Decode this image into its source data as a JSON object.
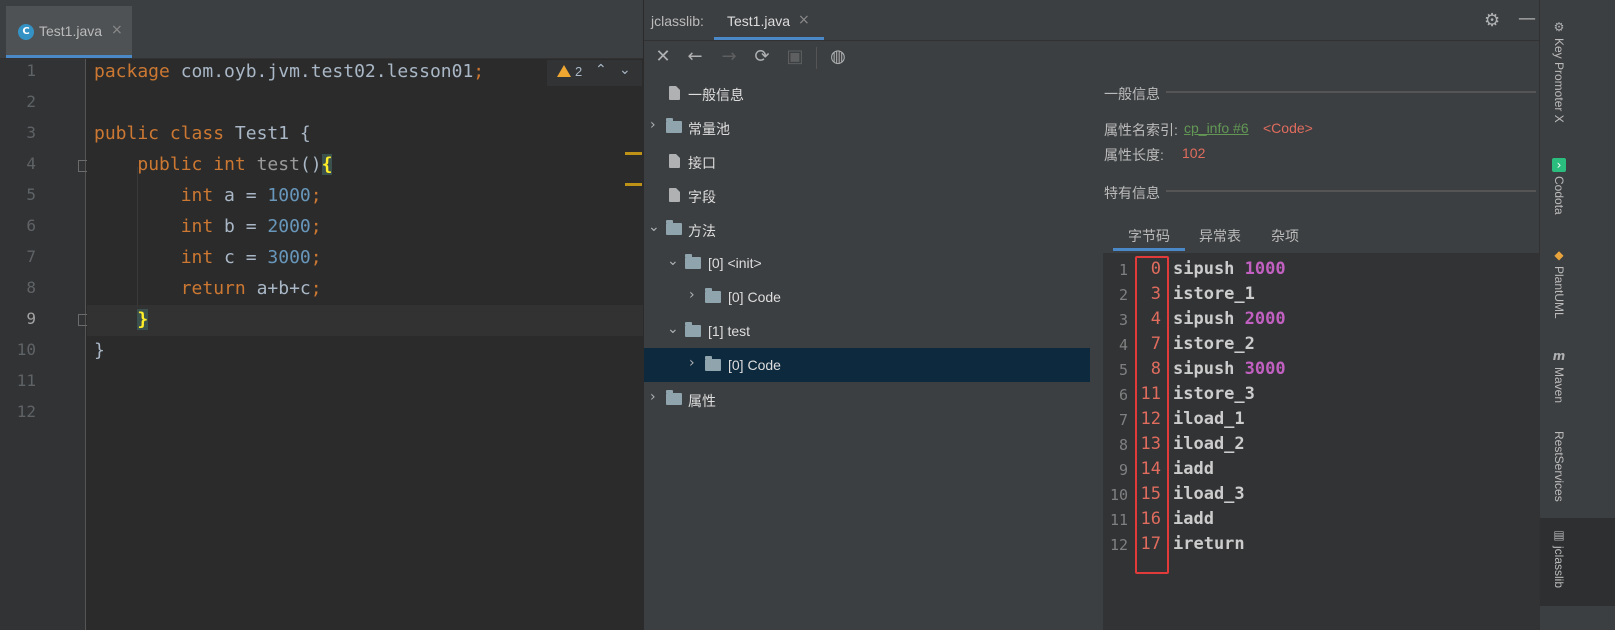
{
  "editor": {
    "tab_label": "Test1.java",
    "tab_icon_letter": "C",
    "close_glyph": "×",
    "inspection": {
      "warning_count": "2"
    },
    "line_numbers": [
      "1",
      "2",
      "3",
      "4",
      "5",
      "6",
      "7",
      "8",
      "9",
      "10",
      "11",
      "12"
    ],
    "code": {
      "l1_kw": "package",
      "l1_rest": " com.oyb.jvm.test02.lesson01",
      "l1_semi": ";",
      "l3_kw1": "public",
      "l3_kw2": "class",
      "l3_cls": "Test1",
      "l3_brace": " {",
      "l4_kw1": "public",
      "l4_kw2": "int",
      "l4_method": "test",
      "l4_parens": "()",
      "l4_brace": "{",
      "l5_kw": "int",
      "l5_var": " a = ",
      "l5_num": "1000",
      "l6_kw": "int",
      "l6_var": " b = ",
      "l6_num": "2000",
      "l7_kw": "int",
      "l7_var": " c = ",
      "l7_num": "3000",
      "l8_kw": "return",
      "l8_expr": " a+b+c",
      "semi": ";",
      "l9_brace": "}",
      "l10_brace": "}"
    }
  },
  "jclasslib": {
    "title": "jclasslib:",
    "tab_label": "Test1.java",
    "close_glyph": "×",
    "toolbar": {
      "close": "✕",
      "back": "←",
      "forward": "→",
      "refresh": "⟳",
      "save": "▣",
      "web": "◍"
    },
    "tree": [
      {
        "label": "一般信息",
        "type": "doc"
      },
      {
        "label": "常量池",
        "type": "folder",
        "arrow": "›"
      },
      {
        "label": "接口",
        "type": "doc"
      },
      {
        "label": "字段",
        "type": "doc"
      },
      {
        "label": "方法",
        "type": "folder",
        "arrow": "⌄"
      },
      {
        "label": "[0] <init>",
        "type": "folder",
        "arrow": "⌄"
      },
      {
        "label": "[0] Code",
        "type": "folder",
        "arrow": "›"
      },
      {
        "label": "[1] test",
        "type": "folder",
        "arrow": "⌄"
      },
      {
        "label": "[0] Code",
        "type": "folder",
        "arrow": "›",
        "selected": true
      },
      {
        "label": "属性",
        "type": "folder",
        "arrow": "›"
      }
    ],
    "detail": {
      "general_title": "一般信息",
      "name_index_label": "属性名索引:",
      "name_index_link": "cp_info #6",
      "name_index_value": "<Code>",
      "length_label": "属性长度:",
      "length_value": "102",
      "specific_title": "特有信息",
      "tabs": [
        "字节码",
        "异常表",
        "杂项"
      ],
      "bytecode": [
        {
          "line": "1",
          "offset": "0",
          "op": "sipush",
          "arg": "1000"
        },
        {
          "line": "2",
          "offset": "3",
          "op": "istore_1",
          "arg": ""
        },
        {
          "line": "3",
          "offset": "4",
          "op": "sipush",
          "arg": "2000"
        },
        {
          "line": "4",
          "offset": "7",
          "op": "istore_2",
          "arg": ""
        },
        {
          "line": "5",
          "offset": "8",
          "op": "sipush",
          "arg": "3000"
        },
        {
          "line": "6",
          "offset": "11",
          "op": "istore_3",
          "arg": ""
        },
        {
          "line": "7",
          "offset": "12",
          "op": "iload_1",
          "arg": ""
        },
        {
          "line": "8",
          "offset": "13",
          "op": "iload_2",
          "arg": ""
        },
        {
          "line": "9",
          "offset": "14",
          "op": "iadd",
          "arg": ""
        },
        {
          "line": "10",
          "offset": "15",
          "op": "iload_3",
          "arg": ""
        },
        {
          "line": "11",
          "offset": "16",
          "op": "iadd",
          "arg": ""
        },
        {
          "line": "12",
          "offset": "17",
          "op": "ireturn",
          "arg": ""
        }
      ]
    },
    "gear_glyph": "⚙",
    "minimize_glyph": "—"
  },
  "tool_strip": [
    {
      "label": "Key Promoter X",
      "icon": "key-promoter-icon",
      "glyph": "⚙"
    },
    {
      "label": "Codota",
      "icon": "codota-icon",
      "glyph": "›"
    },
    {
      "label": "PlantUML",
      "icon": "plantuml-icon",
      "glyph": "◆"
    },
    {
      "label": "Maven",
      "icon": "maven-icon",
      "glyph": "m"
    },
    {
      "label": "RestServices",
      "icon": "",
      "glyph": ""
    },
    {
      "label": "jclasslib",
      "icon": "jclasslib-icon",
      "glyph": "▤"
    }
  ]
}
